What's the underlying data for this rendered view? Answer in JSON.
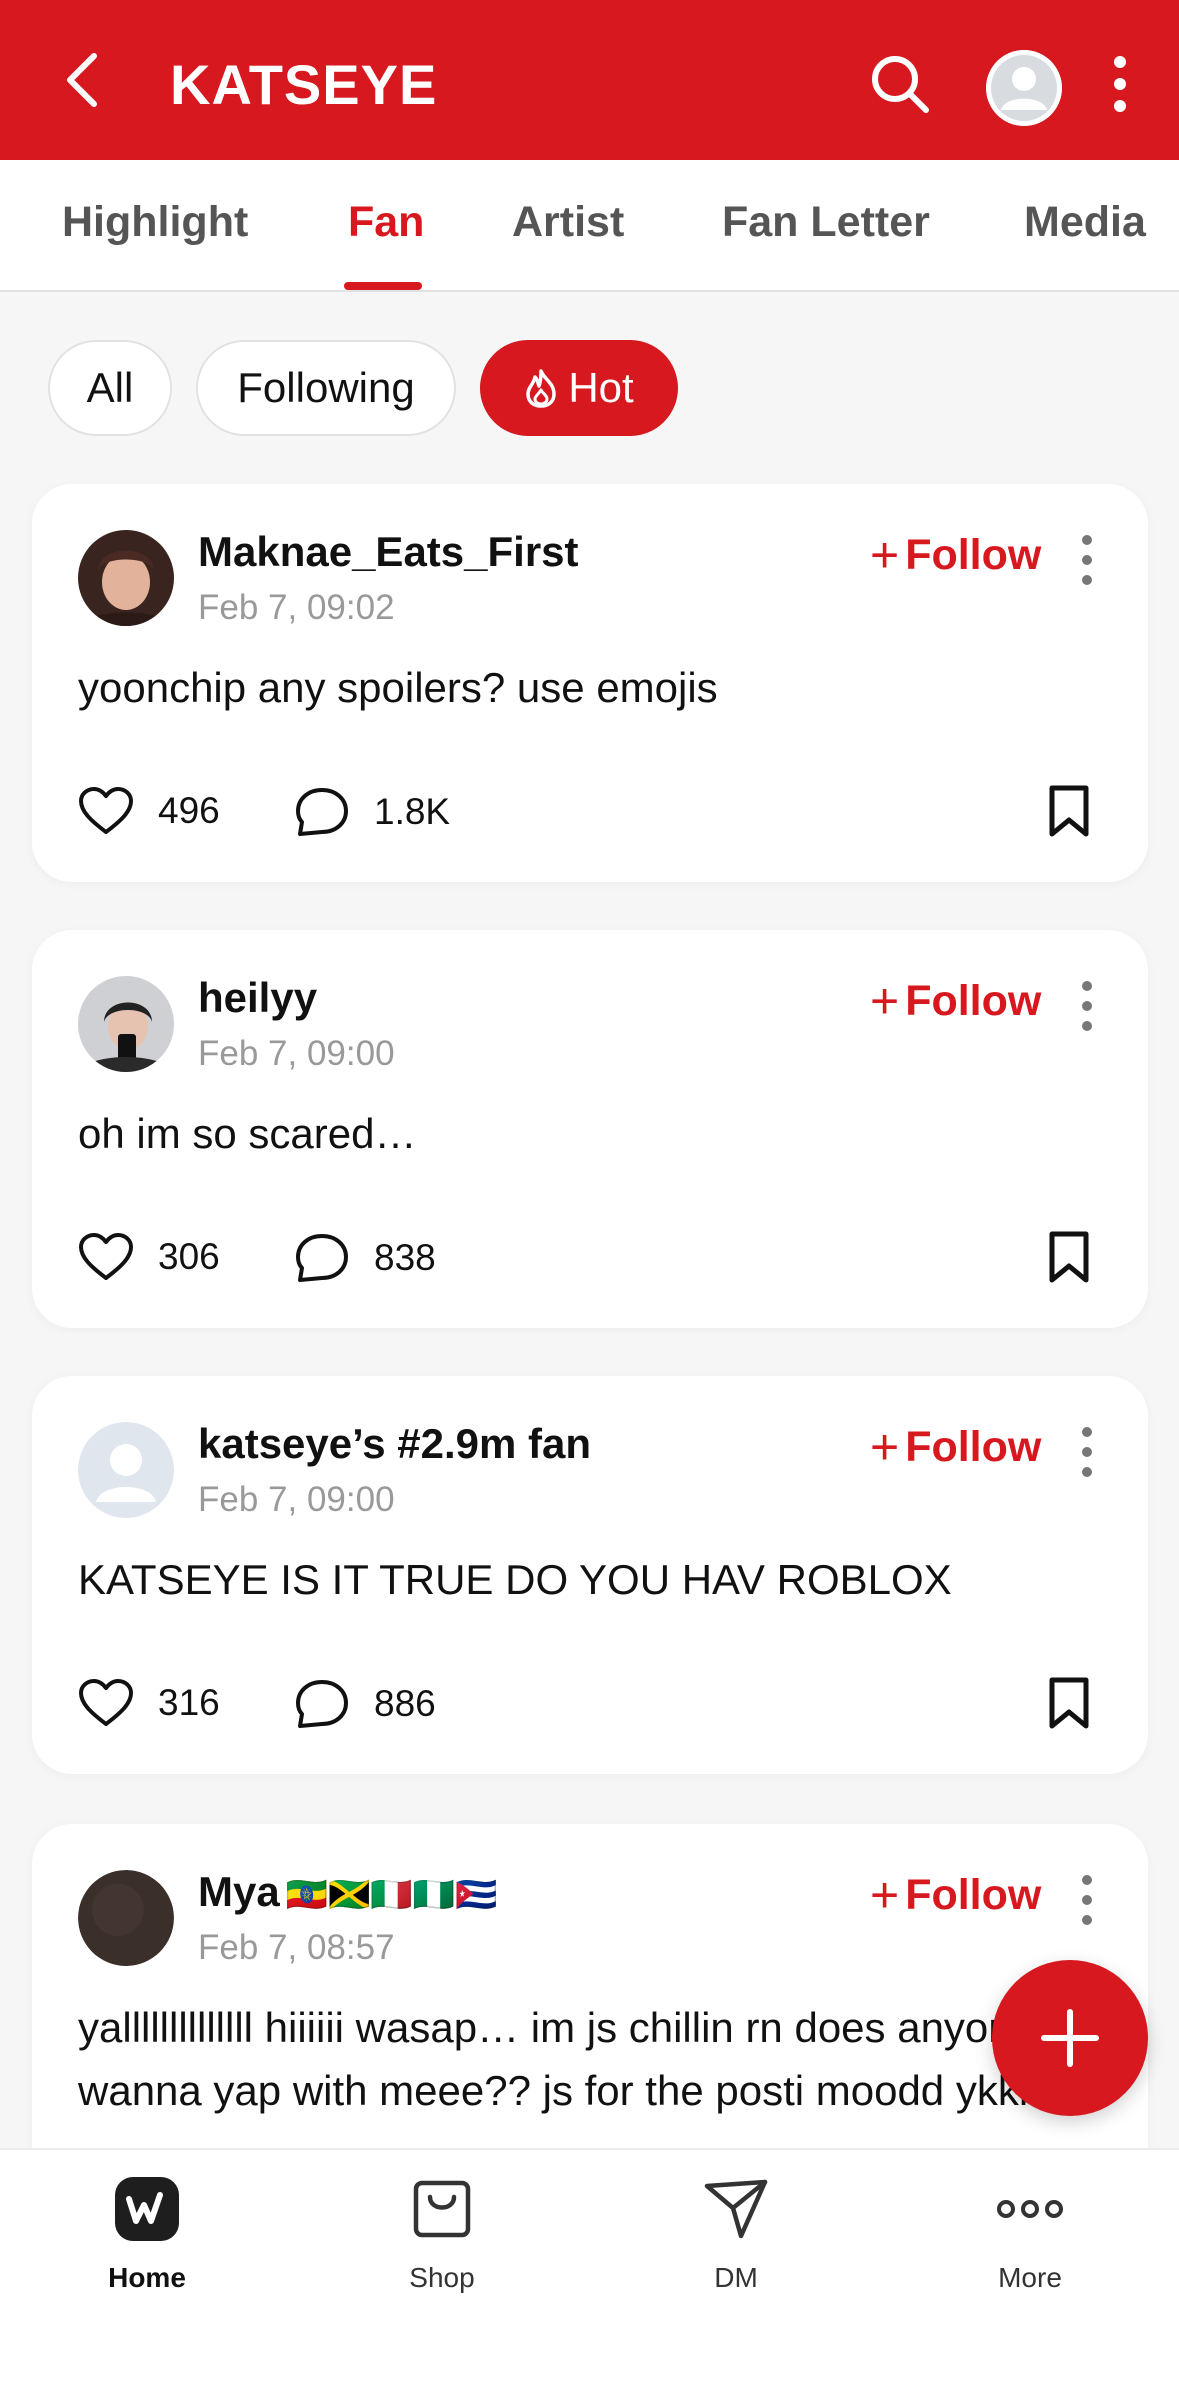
{
  "header": {
    "title": "KATSEYE",
    "brand_color": "#d7191f",
    "icons": [
      "back-icon",
      "search-icon",
      "profile-avatar-icon",
      "more-vertical-icon"
    ]
  },
  "tabs": [
    {
      "label": "Highlight",
      "active": false
    },
    {
      "label": "Fan",
      "active": true
    },
    {
      "label": "Artist",
      "active": false
    },
    {
      "label": "Fan Letter",
      "active": false
    },
    {
      "label": "Media",
      "active": false
    }
  ],
  "filters": [
    {
      "label": "All",
      "active": false
    },
    {
      "label": "Following",
      "active": false
    },
    {
      "label": "Hot",
      "active": true,
      "icon": "flame-icon"
    }
  ],
  "posts": [
    {
      "author": "Maknae_Eats_First",
      "date": "Feb 7, 09:02",
      "follow_label": "Follow",
      "text": "yoonchip any spoilers? use emojis",
      "likes": "496",
      "comments": "1.8K"
    },
    {
      "author": "heilyy",
      "date": "Feb 7, 09:00",
      "follow_label": "Follow",
      "text": "oh im so scared…",
      "likes": "306",
      "comments": "838"
    },
    {
      "author": "katseye’s #2.9m fan",
      "date": "Feb 7, 09:00",
      "follow_label": "Follow",
      "text": "KATSEYE IS IT TRUE DO YOU HAV ROBLOX",
      "likes": "316",
      "comments": "886"
    },
    {
      "author": "Mya",
      "author_flags": "🇪🇹🇯🇲🇮🇹🇳🇬🇨🇺",
      "date": "Feb 7, 08:57",
      "follow_label": "Follow",
      "text": "yallllllllllllll hiiiiii wasap… im js chillin rn does anyone wanna yap with meee?? js for the posti moodd ykkk😣"
    }
  ],
  "bottom_nav": [
    {
      "label": "Home",
      "icon": "weverse-home-icon",
      "active": true
    },
    {
      "label": "Shop",
      "icon": "shopping-bag-icon",
      "active": false
    },
    {
      "label": "DM",
      "icon": "paper-plane-icon",
      "active": false
    },
    {
      "label": "More",
      "icon": "more-horizontal-icon",
      "active": false
    }
  ]
}
